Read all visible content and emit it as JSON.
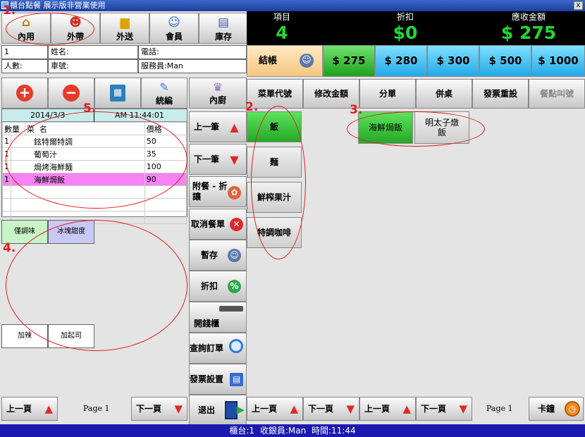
{
  "window": {
    "title": "櫃台點餐 展示版非營業使用",
    "close_label": "x"
  },
  "top_buttons": [
    {
      "label": "內用",
      "icon": "house-icon"
    },
    {
      "label": "外帶",
      "icon": "people-icon"
    },
    {
      "label": "外送",
      "icon": "car-icon"
    },
    {
      "label": "會員",
      "icon": "member-icon"
    },
    {
      "label": "庫存",
      "icon": "inventory-icon"
    }
  ],
  "stats": {
    "items_label": "項目",
    "items_value": "4",
    "discount_label": "折扣",
    "discount_value": "$0",
    "total_label": "應收金額",
    "total_value": "$ 275"
  },
  "fields": {
    "table_no": "1",
    "name_label": "姓名:",
    "phone_label": "電話:",
    "guests_label": "人數:",
    "car_label": "車號:",
    "staff_label": "服務員:Man"
  },
  "checkout_label": "結帳",
  "quick_amounts": [
    "$ 275",
    "$ 280",
    "$ 300",
    "$ 500",
    "$ 1000"
  ],
  "control_buttons": {
    "add_icon": "plus-icon",
    "remove_icon": "minus-icon",
    "calc_icon": "calculator-icon",
    "edit_label": "統編"
  },
  "order": {
    "date": "2014/3/3",
    "time": "AM 11:44:01",
    "headers": [
      "數量",
      "菜",
      "名",
      "價格"
    ],
    "rows": [
      {
        "qty": "1",
        "name": "鉉特爾特調",
        "price": "50"
      },
      {
        "qty": "1",
        "name": "葡萄汁",
        "price": "35"
      },
      {
        "qty": "1",
        "name": "焗烤海鮮麵",
        "price": "100"
      },
      {
        "qty": "1",
        "name": "海鮮焗飯",
        "price": "90"
      }
    ]
  },
  "function_buttons": [
    "菜單代號",
    "修改金額",
    "分單",
    "併桌",
    "發票重設",
    "餐點叫號"
  ],
  "side_buttons": [
    "內廚",
    "上一筆",
    "下一筆",
    "附餐 - 折讓",
    "取消餐單",
    "暫存",
    "折扣",
    "開錢櫃",
    "查詢訂單",
    "發票設置",
    "退出"
  ],
  "categories": [
    "飯",
    "麵",
    "鮮榨果汁",
    "特調咖啡"
  ],
  "items": [
    "海鮮焗飯",
    "明太子燉飯"
  ],
  "modifiers": [
    "僅調味",
    "冰塊甜度",
    "加辣",
    "加起司"
  ],
  "bottom": {
    "prev_label": "上一頁",
    "next_label": "下一頁",
    "page_left": "Page 1",
    "page_right": "Page 1",
    "clock_label": "卡鐘"
  },
  "status": {
    "text": "櫃台:1    收銀員:Man    時間:11:44"
  },
  "annotations": [
    "1.",
    "2.",
    "3.",
    "4.",
    "5."
  ],
  "colors": {
    "accent_green": "#22d733",
    "category_selected": "#25a825",
    "quick_blue": "#22a9e6",
    "highlight_pink": "#f682f4",
    "status_blue": "#1a1ab0"
  }
}
